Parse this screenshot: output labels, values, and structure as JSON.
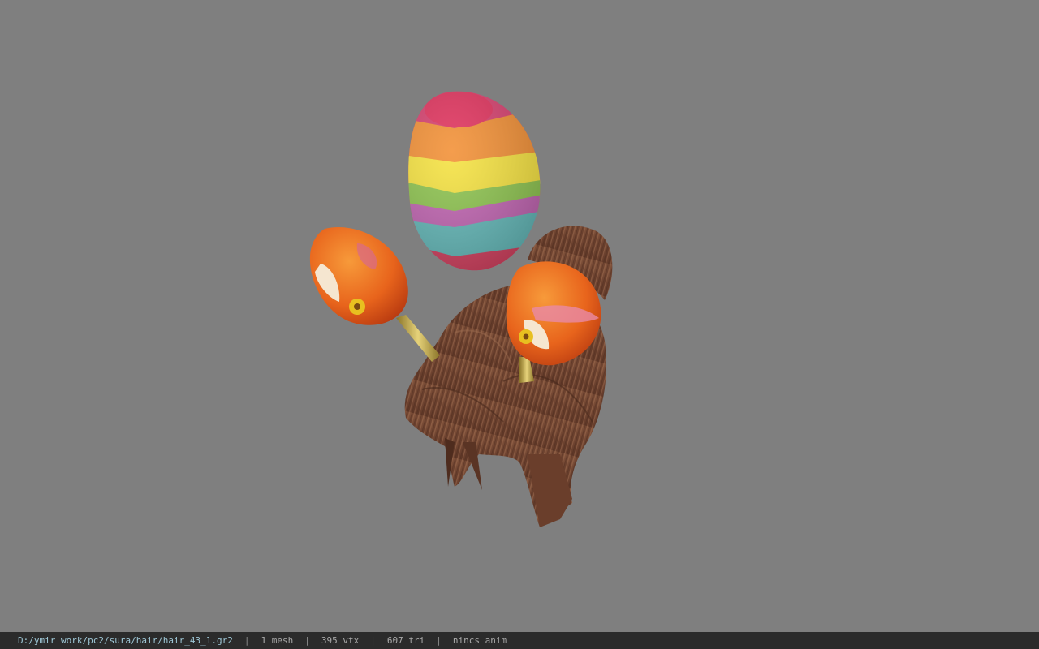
{
  "status_bar": {
    "file_path": "D:/ymir work/pc2/sura/hair/hair_43_1.gr2",
    "separator": "|",
    "mesh_count": "1 mesh",
    "vertex_count": "395 vtx",
    "triangle_count": "607 tri",
    "animation": "nincs anim"
  },
  "colors": {
    "viewport_background": "#7f7f7f",
    "status_background": "#2b2b2b",
    "hair": "#7a4a33",
    "path_text": "#9ec7d6"
  }
}
